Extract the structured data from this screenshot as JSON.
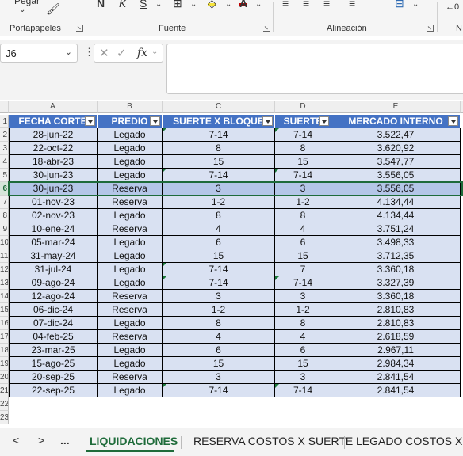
{
  "ribbon": {
    "pegar_label": "Pegar",
    "groups": [
      "Portapapeles",
      "Fuente",
      "Alineación",
      "N"
    ]
  },
  "formula_bar": {
    "name_box": "J6",
    "fx_label": "fx",
    "formula_value": ""
  },
  "columns": [
    "A",
    "B",
    "C",
    "D",
    "E"
  ],
  "headers": [
    "FECHA CORTE",
    "PREDIO",
    "SUERTE X BLOQUE",
    "SUERTE",
    "MERCADO INTERNO"
  ],
  "row_numbers": [
    "1",
    "2",
    "3",
    "4",
    "5",
    "6",
    "7",
    "8",
    "9",
    "10",
    "11",
    "12",
    "13",
    "14",
    "15",
    "16",
    "17",
    "18",
    "19",
    "20",
    "21",
    "22",
    "23"
  ],
  "rows": [
    [
      "28-jun-22",
      "Legado",
      "7-14",
      "7-14",
      "3.522,47"
    ],
    [
      "22-oct-22",
      "Legado",
      "8",
      "8",
      "3.620,92"
    ],
    [
      "18-abr-23",
      "Legado",
      "15",
      "15",
      "3.547,77"
    ],
    [
      "30-jun-23",
      "Legado",
      "7-14",
      "7-14",
      "3.556,05"
    ],
    [
      "30-jun-23",
      "Reserva",
      "3",
      "3",
      "3.556,05"
    ],
    [
      "01-nov-23",
      "Reserva",
      "1-2",
      "1-2",
      "4.134,44"
    ],
    [
      "02-nov-23",
      "Legado",
      "8",
      "8",
      "4.134,44"
    ],
    [
      "10-ene-24",
      "Reserva",
      "4",
      "4",
      "3.751,24"
    ],
    [
      "05-mar-24",
      "Legado",
      "6",
      "6",
      "3.498,33"
    ],
    [
      "31-may-24",
      "Legado",
      "15",
      "15",
      "3.712,35"
    ],
    [
      "31-jul-24",
      "Legado",
      "7-14",
      "7",
      "3.360,18"
    ],
    [
      "09-ago-24",
      "Legado",
      "7-14",
      "7-14",
      "3.327,39"
    ],
    [
      "12-ago-24",
      "Reserva",
      "3",
      "3",
      "3.360,18"
    ],
    [
      "06-dic-24",
      "Reserva",
      "1-2",
      "1-2",
      "2.810,83"
    ],
    [
      "07-dic-24",
      "Legado",
      "8",
      "8",
      "2.810,83"
    ],
    [
      "04-feb-25",
      "Reserva",
      "4",
      "4",
      "2.618,59"
    ],
    [
      "23-mar-25",
      "Legado",
      "6",
      "6",
      "2.967,11"
    ],
    [
      "15-ago-25",
      "Legado",
      "15",
      "15",
      "2.984,34"
    ],
    [
      "20-sep-25",
      "Reserva",
      "3",
      "3",
      "2.841,54"
    ],
    [
      "22-sep-25",
      "Legado",
      "7-14",
      "7-14",
      "2.841,54"
    ]
  ],
  "selected_row_index": 4,
  "tabs": {
    "items": [
      "LIQUIDACIONES",
      "RESERVA COSTOS X SUERTE",
      "LEGADO COSTOS X SU"
    ],
    "active": "LIQUIDACIONES",
    "nav": [
      "<",
      ">",
      "..."
    ]
  },
  "colors": {
    "header_fill": "#4472c4",
    "band_fill": "#d9e1f2",
    "selected_fill": "#b4c6e7",
    "accent": "#1e6b3a"
  }
}
